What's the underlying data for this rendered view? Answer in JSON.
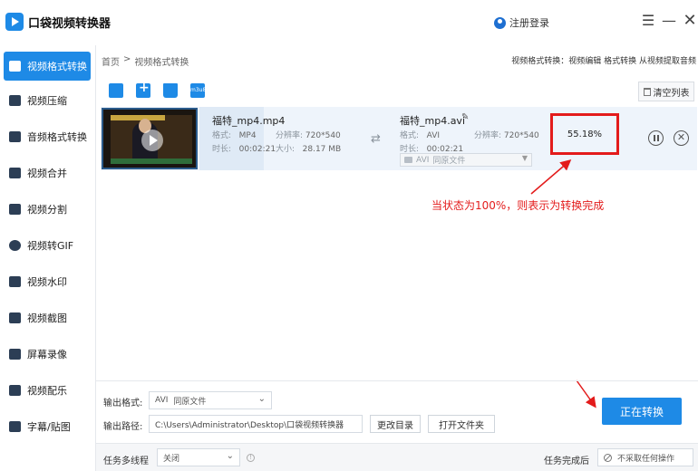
{
  "app": {
    "title": "口袋视频转换器",
    "login_label": "注册登录"
  },
  "window": {
    "menu_glyph": "☰",
    "min_glyph": "—",
    "close_glyph": "✕"
  },
  "sidebar": {
    "items": [
      {
        "label": "视频格式转换",
        "icon": "video-icon",
        "active": true
      },
      {
        "label": "视频压缩",
        "icon": "compress-icon"
      },
      {
        "label": "音频格式转换",
        "icon": "audio-icon"
      },
      {
        "label": "视频合并",
        "icon": "merge-icon"
      },
      {
        "label": "视频分割",
        "icon": "split-icon"
      },
      {
        "label": "视频转GIF",
        "icon": "gif-icon"
      },
      {
        "label": "视频水印",
        "icon": "watermark-icon"
      },
      {
        "label": "视频截图",
        "icon": "screenshot-icon"
      },
      {
        "label": "屏幕录像",
        "icon": "screen-record-icon"
      },
      {
        "label": "视频配乐",
        "icon": "music-icon"
      },
      {
        "label": "字幕/贴图",
        "icon": "subtitle-icon"
      }
    ]
  },
  "breadcrumb": {
    "home": "首页",
    "sep": ">",
    "current": "视频格式转换"
  },
  "top_links": "视频格式转换：视频编辑 格式转换 从视频提取音频",
  "toolbar": {
    "clear_label": "清空列表",
    "m3u8_label": "m3u8"
  },
  "file": {
    "source": {
      "name": "福特_mp4.mp4",
      "format_label": "格式:",
      "format": "MP4",
      "resolution_label": "分辨率:",
      "resolution": "720*540",
      "duration_label": "时长:",
      "duration": "00:02:21",
      "size_label": "大小:",
      "size": "28.17 MB"
    },
    "output": {
      "name": "福特_mp4.avi",
      "format_label": "格式:",
      "format": "AVI",
      "resolution_label": "分辨率:",
      "resolution": "720*540",
      "duration_label": "时长:",
      "duration": "00:02:21",
      "select_format": "AVI",
      "select_quality": "同原文件"
    },
    "progress": "55.18%"
  },
  "annotation": "当状态为100%，则表示为转换完成",
  "settings": {
    "output_format_label": "输出格式:",
    "output_format": "AVI",
    "output_quality": "同原文件",
    "output_path_label": "输出路径:",
    "output_path": "C:\\Users\\Administrator\\Desktop\\口袋视频转换器",
    "change_dir_label": "更改目录",
    "open_folder_label": "打开文件夹",
    "convert_label": "正在转换",
    "multithread_label": "任务多线程",
    "multithread_value": "关闭",
    "after_task_label": "任务完成后",
    "after_task_value": "不采取任何操作"
  },
  "colors": {
    "accent": "#1e8ae6",
    "highlight": "#e31b1b",
    "row_bg": "#eef4fb"
  }
}
